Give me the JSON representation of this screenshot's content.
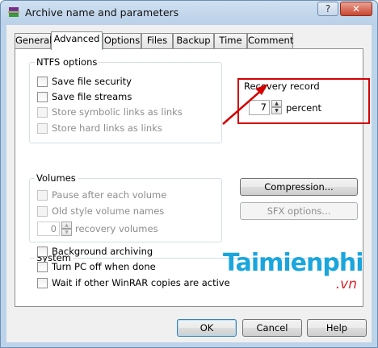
{
  "window": {
    "title": "Archive name and parameters",
    "help_button": "?",
    "close_button": "✕"
  },
  "tabs": [
    {
      "label": "General",
      "active": false
    },
    {
      "label": "Advanced",
      "active": true
    },
    {
      "label": "Options",
      "active": false
    },
    {
      "label": "Files",
      "active": false
    },
    {
      "label": "Backup",
      "active": false
    },
    {
      "label": "Time",
      "active": false
    },
    {
      "label": "Comment",
      "active": false
    }
  ],
  "ntfs": {
    "label": "NTFS options",
    "items": [
      {
        "label": "Save file security",
        "checked": false,
        "enabled": true
      },
      {
        "label": "Save file streams",
        "checked": false,
        "enabled": true
      },
      {
        "label": "Store symbolic links as links",
        "checked": false,
        "enabled": false
      },
      {
        "label": "Store hard links as links",
        "checked": false,
        "enabled": false
      }
    ]
  },
  "recovery": {
    "label": "Recovery record",
    "value": "7",
    "unit": "percent"
  },
  "volumes": {
    "label": "Volumes",
    "items": [
      {
        "label": "Pause after each volume",
        "checked": false,
        "enabled": false
      },
      {
        "label": "Old style volume names",
        "checked": false,
        "enabled": false
      }
    ],
    "recovery_volumes_value": "0",
    "recovery_volumes_label": "recovery volumes"
  },
  "buttons": {
    "compression": "Compression...",
    "sfx_options": "SFX options...",
    "ok": "OK",
    "cancel": "Cancel",
    "help": "Help"
  },
  "system": {
    "label": "System",
    "items": [
      {
        "label": "Background archiving",
        "checked": false,
        "enabled": true
      },
      {
        "label": "Turn PC off when done",
        "checked": false,
        "enabled": true
      },
      {
        "label": "Wait if other WinRAR copies are active",
        "checked": false,
        "enabled": true
      }
    ]
  },
  "watermark": {
    "main": "Taimienphi",
    "sub": ".vn"
  },
  "colors": {
    "highlight": "#d40000",
    "watermark_blue": "#1aa6dd",
    "watermark_red": "#d9262c"
  }
}
